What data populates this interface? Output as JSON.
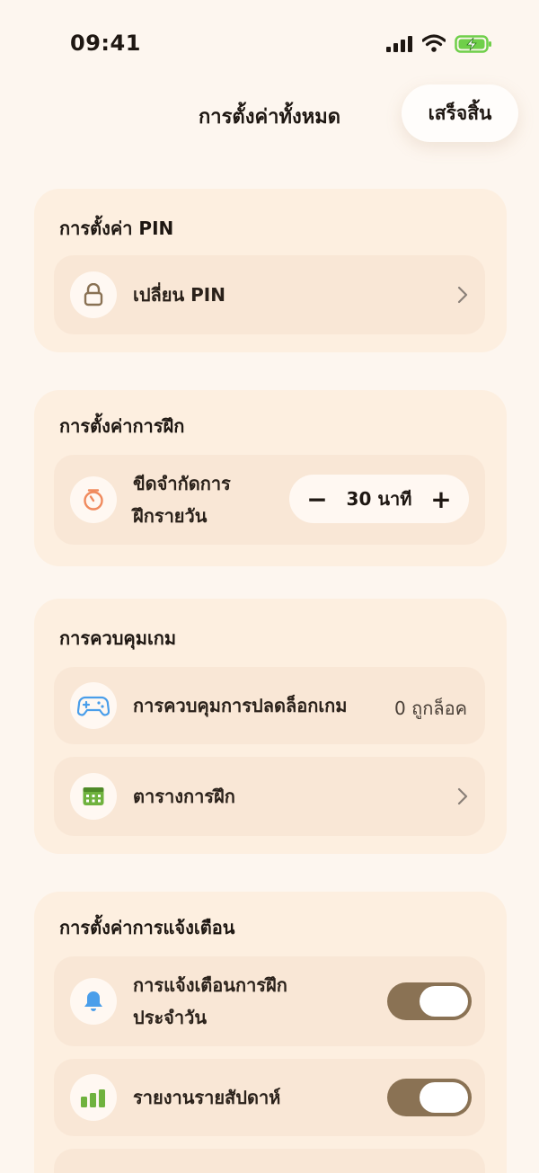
{
  "status": {
    "time": "09:41"
  },
  "nav": {
    "title": "การตั้งค่าทั้งหมด",
    "done_label": "เสร็จสิ้น"
  },
  "pin_section": {
    "title": "การตั้งค่า PIN",
    "change_pin": {
      "label": "เปลี่ยน PIN",
      "icon": "lock-icon"
    }
  },
  "practice_section": {
    "title": "การตั้งค่าการฝึก",
    "daily_limit": {
      "label_line1": "ขีดจำกัดการ",
      "label_line2": "ฝึกรายวัน",
      "value": "30 นาที",
      "decrement": "−",
      "increment": "+",
      "icon": "timer-icon"
    }
  },
  "game_section": {
    "title": "การควบคุมเกม",
    "unlock_control": {
      "label": "การควบคุมการปลดล็อกเกม",
      "value": "0 ถูกล็อค",
      "icon": "gamepad-icon"
    },
    "schedule": {
      "label": "ตารางการฝึก",
      "icon": "calendar-icon"
    }
  },
  "notification_section": {
    "title": "การตั้งค่าการแจ้งเตือน",
    "daily_reminder": {
      "label_line1": "การแจ้งเตือนการฝึก",
      "label_line2": "ประจำวัน",
      "enabled": true,
      "icon": "bell-icon"
    },
    "weekly_report": {
      "label": "รายงานรายสัปดาห์",
      "enabled": true,
      "icon": "bar-chart-icon"
    }
  },
  "colors": {
    "background": "#fdf6ef",
    "card": "#fdefe0",
    "row": "#f9e7d6",
    "toggle_on": "#8a7254",
    "accent_orange": "#f08a5d",
    "accent_blue": "#4a9eea",
    "accent_green": "#6fb23e"
  }
}
